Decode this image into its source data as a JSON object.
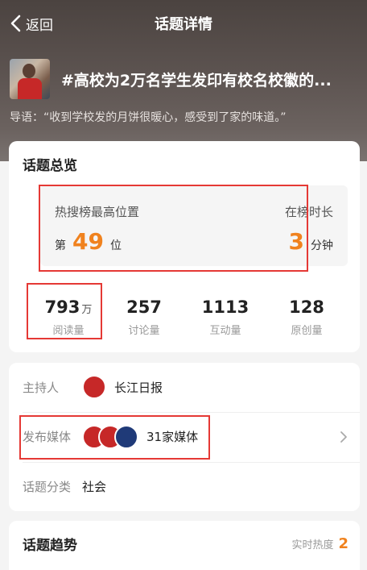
{
  "navbar": {
    "back_label": "返回",
    "title": "话题详情"
  },
  "topic": {
    "title": "#高校为2万名学生发印有校名校徽的...",
    "lead": "导语：“收到学校发的月饼很暖心，感受到了家的味道。”"
  },
  "overview": {
    "section_title": "话题总览",
    "rank": {
      "highest_label": "热搜榜最高位置",
      "highest_prefix": "第",
      "highest_value": "49",
      "highest_suffix": "位",
      "duration_label": "在榜时长",
      "duration_value": "3",
      "duration_unit": "分钟"
    },
    "stats": [
      {
        "value": "793",
        "unit": "万",
        "label": "阅读量"
      },
      {
        "value": "257",
        "unit": "",
        "label": "讨论量"
      },
      {
        "value": "1113",
        "unit": "",
        "label": "互动量"
      },
      {
        "value": "128",
        "unit": "",
        "label": "原创量"
      }
    ]
  },
  "info": {
    "host_label": "主持人",
    "host_value": "长江日报",
    "media_label": "发布媒体",
    "media_value": "31家媒体",
    "category_label": "话题分类",
    "category_value": "社会"
  },
  "trend": {
    "section_title": "话题趋势",
    "realtime_label": "实时热度",
    "realtime_value": "2"
  },
  "colors": {
    "accent": "#f0821e",
    "highlight": "#e53935"
  }
}
